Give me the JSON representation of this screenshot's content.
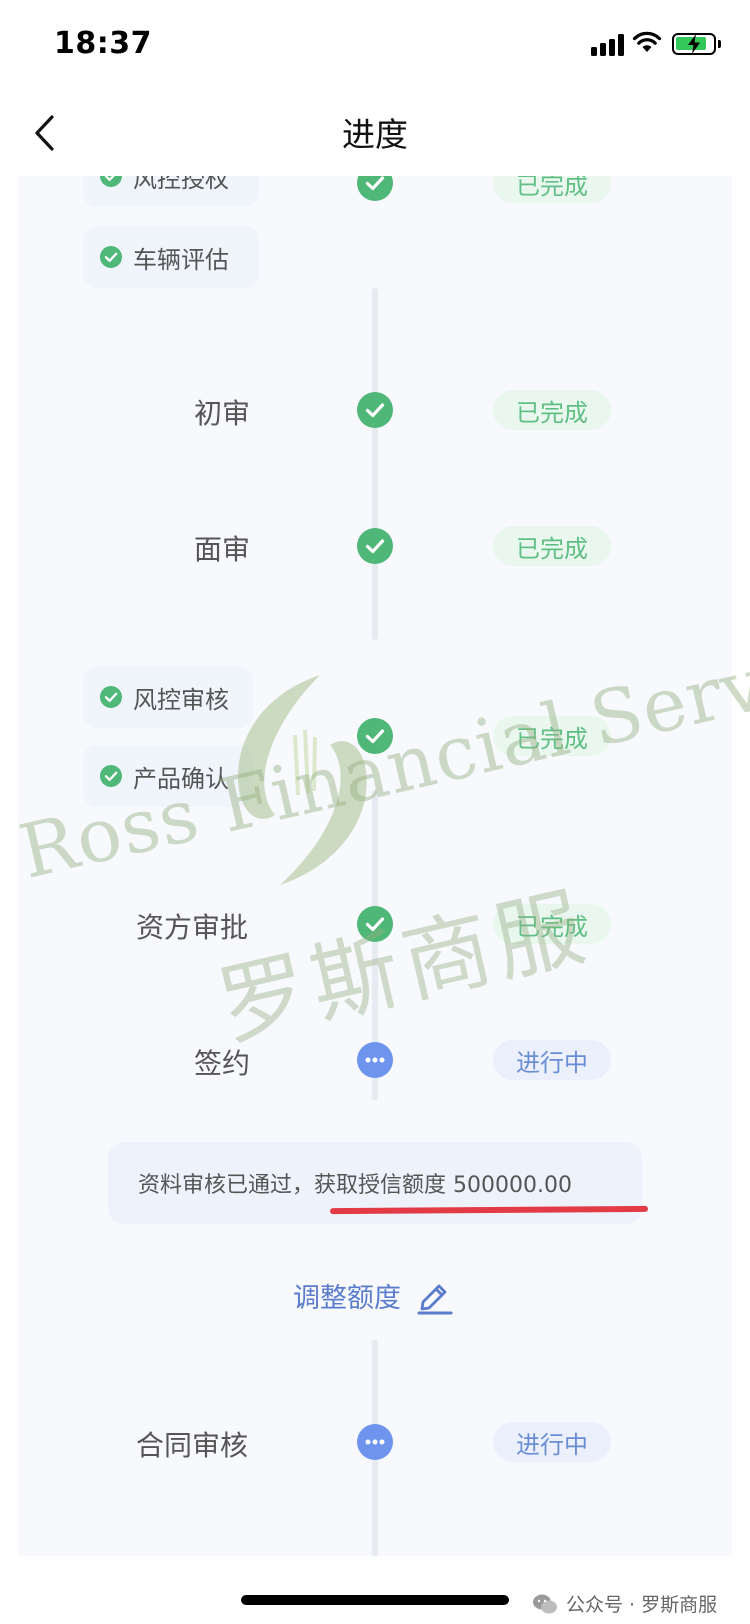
{
  "status_bar": {
    "time": "18:37"
  },
  "nav": {
    "title": "进度"
  },
  "sub_steps": [
    {
      "label": "风控授权"
    },
    {
      "label": "车辆评估"
    },
    {
      "label": "风控审核"
    },
    {
      "label": "产品确认"
    }
  ],
  "steps": [
    {
      "label": "",
      "status": "已完成",
      "state": "done"
    },
    {
      "label": "初审",
      "status": "已完成",
      "state": "done"
    },
    {
      "label": "面审",
      "status": "已完成",
      "state": "done"
    },
    {
      "label": "",
      "status": "已完成",
      "state": "done"
    },
    {
      "label": "资方审批",
      "status": "已完成",
      "state": "done"
    },
    {
      "label": "签约",
      "status": "进行中",
      "state": "in_progress"
    },
    {
      "label": "合同审核",
      "status": "进行中",
      "state": "in_progress"
    }
  ],
  "credit_info": {
    "prefix": "资料审核已通过，",
    "highlight": "获取授信额度 500000.00"
  },
  "adjust": {
    "label": "调整额度"
  },
  "watermark": {
    "english": "Ross Financial Services",
    "chinese": "罗斯商服"
  },
  "footer": {
    "source_label": "公众号 · 罗斯商服"
  },
  "colors": {
    "done_green": "#4fb777",
    "progress_blue": "#6f94ee",
    "link_blue": "#5b7ccc",
    "highlight_red": "#e23b45"
  }
}
